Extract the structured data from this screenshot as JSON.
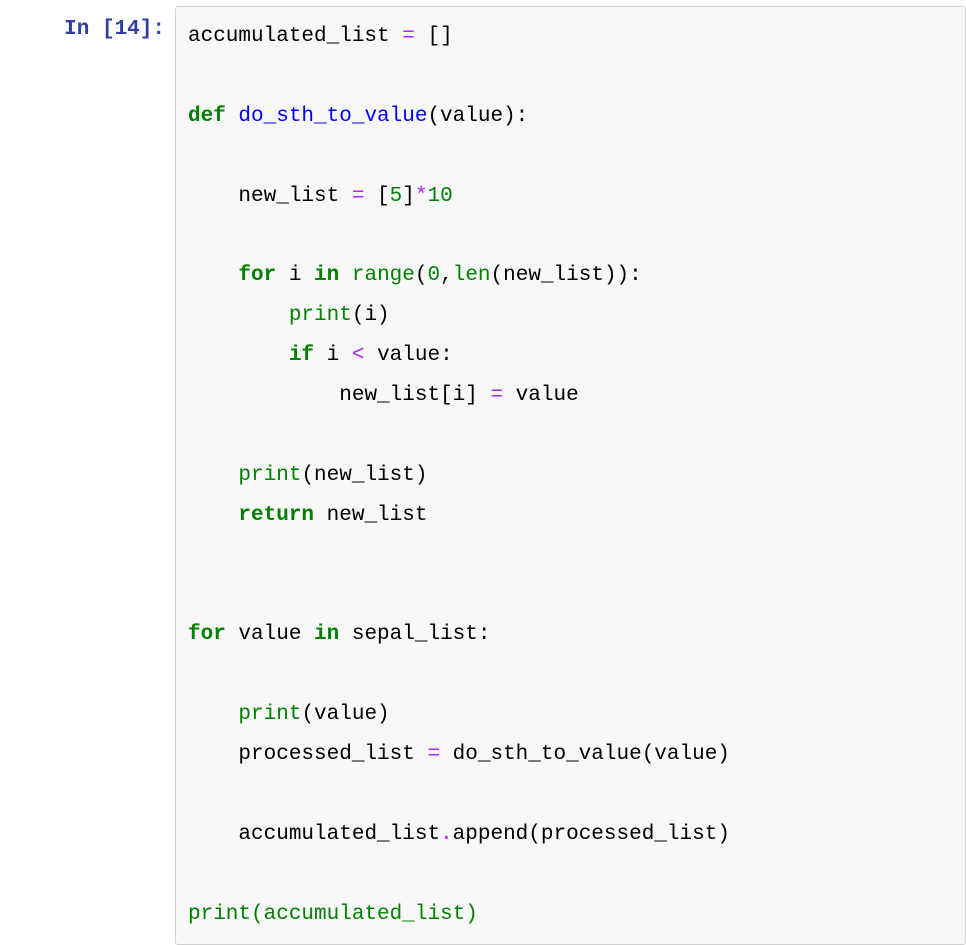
{
  "prompt": {
    "in_text": "In ",
    "open_bracket": "[",
    "number": "14",
    "close_bracket": "]: "
  },
  "code": {
    "l1": {
      "t1": "accumulated_list ",
      "op": "=",
      "t2": " []"
    },
    "l3": {
      "kw": "def",
      "sp": " ",
      "fn": "do_sth_to_value",
      "rest": "(value):"
    },
    "l5": {
      "indent": "    ",
      "t1": "new_list ",
      "op1": "=",
      "t2": " [",
      "n1": "5",
      "t3": "]",
      "op2": "*",
      "n2": "10"
    },
    "l7": {
      "indent": "    ",
      "kw1": "for",
      "t1": " i ",
      "kw2": "in",
      "t2": " ",
      "bi": "range",
      "t3": "(",
      "n1": "0",
      "t4": ",",
      "bi2": "len",
      "t5": "(new_list)):"
    },
    "l8": {
      "indent": "        ",
      "bi": "print",
      "rest": "(i)"
    },
    "l9": {
      "indent": "        ",
      "kw": "if",
      "t1": " i ",
      "op": "<",
      "t2": " value:"
    },
    "l10": {
      "indent": "            ",
      "t1": "new_list[i] ",
      "op": "=",
      "t2": " value"
    },
    "l12": {
      "indent": "    ",
      "bi": "print",
      "rest": "(new_list)"
    },
    "l13": {
      "indent": "    ",
      "kw": "return",
      "rest": " new_list"
    },
    "l16": {
      "kw1": "for",
      "t1": " value ",
      "kw2": "in",
      "rest": " sepal_list:"
    },
    "l18": {
      "indent": "    ",
      "bi": "print",
      "rest": "(value)"
    },
    "l19": {
      "indent": "    ",
      "t1": "processed_list ",
      "op": "=",
      "t2": " do_sth_to_value(value)"
    },
    "l21": {
      "indent": "    ",
      "t1": "accumulated_list",
      "op": ".",
      "t2": "append(processed_list)"
    },
    "l23": {
      "bi": "print",
      "p1": "(",
      "t1": "accumulated_list",
      "p2": ")"
    }
  }
}
